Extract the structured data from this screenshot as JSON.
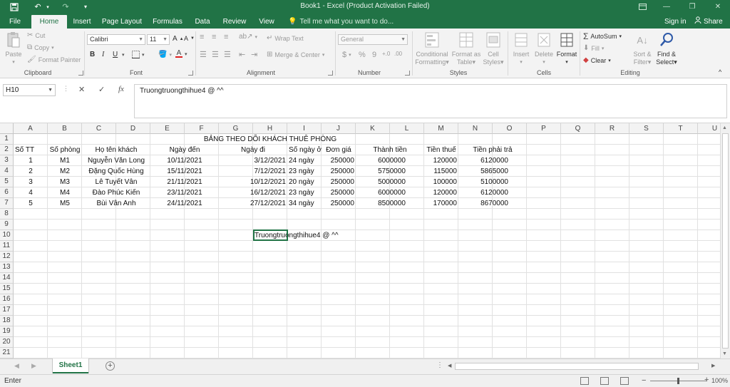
{
  "app": {
    "title": "Book1  -  Excel (Product Activation Failed)"
  },
  "qat": {
    "save_icon": "save-icon",
    "undo_icon": "undo-icon",
    "redo_icon": "redo-icon",
    "customize_icon": "customize-qat-icon"
  },
  "tabs": [
    "File",
    "Home",
    "Insert",
    "Page Layout",
    "Formulas",
    "Data",
    "Review",
    "View"
  ],
  "active_tab": "Home",
  "tell_me": "Tell me what you want to do...",
  "sign_in": "Sign in",
  "share": "Share",
  "ribbon": {
    "clipboard": {
      "label": "Clipboard",
      "paste": "Paste",
      "cut": "Cut",
      "copy": "Copy",
      "format_painter": "Format Painter"
    },
    "font": {
      "label": "Font",
      "name": "Calibri",
      "size": "11",
      "bold": "B",
      "italic": "I",
      "underline": "U"
    },
    "alignment": {
      "label": "Alignment",
      "wrap": "Wrap Text",
      "merge": "Merge & Center"
    },
    "number": {
      "label": "Number",
      "format": "General",
      "currency": "$",
      "percent": "%",
      "comma": "9"
    },
    "styles": {
      "label": "Styles",
      "conditional": [
        "Conditional",
        "Formatting"
      ],
      "table": [
        "Format as",
        "Table"
      ],
      "cell": [
        "Cell",
        "Styles"
      ]
    },
    "cells": {
      "label": "Cells",
      "insert": "Insert",
      "delete": "Delete",
      "format": "Format"
    },
    "editing": {
      "label": "Editing",
      "autosum": "AutoSum",
      "fill": "Fill",
      "clear": "Clear",
      "sort": [
        "Sort &",
        "Filter"
      ],
      "find": [
        "Find &",
        "Select"
      ]
    }
  },
  "formula_bar": {
    "name_box": "H10",
    "cancel": "✕",
    "enter": "✓",
    "fx": "fx",
    "content": "Truongtruongthihue4 @ ^^"
  },
  "columns": [
    "A",
    "B",
    "C",
    "D",
    "E",
    "F",
    "G",
    "H",
    "I",
    "J",
    "K",
    "L",
    "M",
    "N",
    "O",
    "P",
    "Q",
    "R",
    "S",
    "T",
    "U"
  ],
  "rows": [
    "1",
    "2",
    "3",
    "4",
    "5",
    "6",
    "7",
    "8",
    "9",
    "10",
    "11",
    "12",
    "13",
    "14",
    "15",
    "16",
    "17",
    "18",
    "19",
    "20",
    "21"
  ],
  "sheet": {
    "title": "BẢNG THEO DÕI KHÁCH THUÊ PHÒNG",
    "headers": [
      "Số TT",
      "Số phòng",
      "Họ tên khách",
      "Ngày đến",
      "Ngày đi",
      "Số ngày ở",
      "Đơn giá",
      "Thành tiền",
      "Tiền thuế",
      "Tiền phải trả"
    ],
    "records": [
      [
        "1",
        "M1",
        "Nguyễn Văn Long",
        "10/11/2021",
        "3/12/2021",
        "24 ngày",
        "250000",
        "6000000",
        "120000",
        "6120000"
      ],
      [
        "2",
        "M2",
        "Đặng Quốc Hùng",
        "15/11/2021",
        "7/12/2021",
        "23 ngày",
        "250000",
        "5750000",
        "115000",
        "5865000"
      ],
      [
        "3",
        "M3",
        "Lê Tuyết Vân",
        "21/11/2021",
        "10/12/2021",
        "20 ngày",
        "250000",
        "5000000",
        "100000",
        "5100000"
      ],
      [
        "4",
        "M4",
        "Đào Phúc Kiến",
        "23/11/2021",
        "16/12/2021",
        "23 ngày",
        "250000",
        "6000000",
        "120000",
        "6120000"
      ],
      [
        "5",
        "M5",
        "Bùi Vân Anh",
        "24/11/2021",
        "27/12/2021",
        "34 ngày",
        "250000",
        "8500000",
        "170000",
        "8670000"
      ]
    ],
    "note": "Truongtruongthihue4 @ ^^"
  },
  "sheet_tabs": [
    "Sheet1"
  ],
  "status": {
    "mode": "Enter",
    "zoom": "100%"
  }
}
